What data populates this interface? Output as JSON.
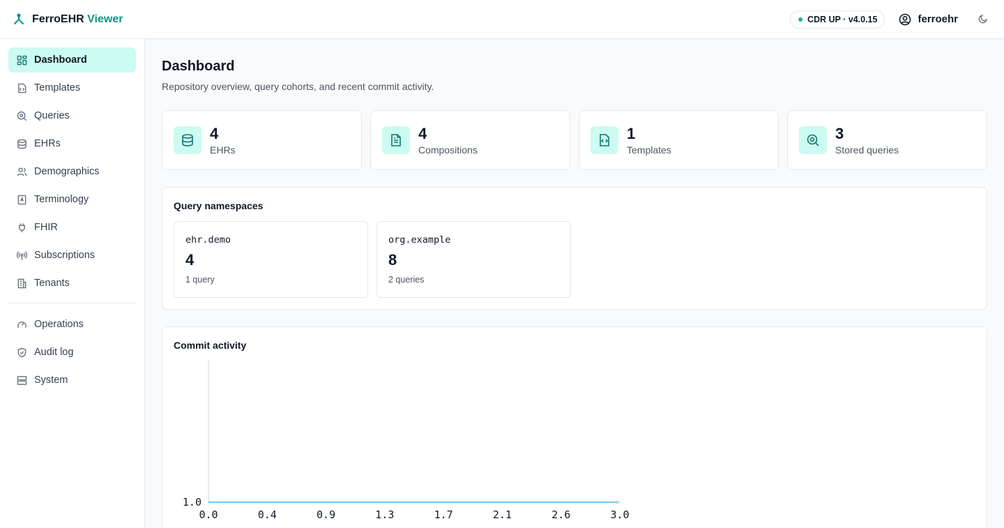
{
  "header": {
    "brand_name": "FerroEHR",
    "brand_suffix": "Viewer",
    "status": "CDR UP · v4.0.15",
    "username": "ferroehr",
    "accent_color": "#0d9488"
  },
  "sidebar": {
    "items": [
      {
        "label": "Dashboard",
        "icon": "dashboard-icon",
        "active": true
      },
      {
        "label": "Templates",
        "icon": "file-code-icon"
      },
      {
        "label": "Queries",
        "icon": "search-icon"
      },
      {
        "label": "EHRs",
        "icon": "database-icon"
      },
      {
        "label": "Demographics",
        "icon": "users-icon"
      },
      {
        "label": "Terminology",
        "icon": "book-icon"
      },
      {
        "label": "FHIR",
        "icon": "plug-icon"
      },
      {
        "label": "Subscriptions",
        "icon": "radio-icon"
      },
      {
        "label": "Tenants",
        "icon": "building-icon"
      }
    ],
    "secondary_items": [
      {
        "label": "Operations",
        "icon": "gauge-icon"
      },
      {
        "label": "Audit log",
        "icon": "shield-icon"
      },
      {
        "label": "System",
        "icon": "server-icon"
      }
    ]
  },
  "page": {
    "title": "Dashboard",
    "subtitle": "Repository overview, query cohorts, and recent commit activity."
  },
  "stats": [
    {
      "value": "4",
      "label": "EHRs",
      "icon": "database-icon"
    },
    {
      "value": "4",
      "label": "Compositions",
      "icon": "document-icon"
    },
    {
      "value": "1",
      "label": "Templates",
      "icon": "file-code-icon"
    },
    {
      "value": "3",
      "label": "Stored queries",
      "icon": "search-icon"
    }
  ],
  "namespaces": {
    "title": "Query namespaces",
    "items": [
      {
        "name": "ehr.demo",
        "count": "4",
        "sub": "1 query"
      },
      {
        "name": "org.example",
        "count": "8",
        "sub": "2 queries"
      }
    ]
  },
  "commit_activity": {
    "title": "Commit activity"
  },
  "chart_data": {
    "type": "line",
    "title": "",
    "xlabel": "",
    "ylabel": "",
    "x_ticks": [
      "0.0",
      "0.4",
      "0.9",
      "1.3",
      "1.7",
      "2.1",
      "2.6",
      "3.0"
    ],
    "y_ticks": [
      "1.0"
    ],
    "xlim": [
      0,
      3
    ],
    "series": [
      {
        "x": [
          0,
          3
        ],
        "y": [
          1,
          1
        ],
        "color": "#38bdf8"
      }
    ]
  }
}
